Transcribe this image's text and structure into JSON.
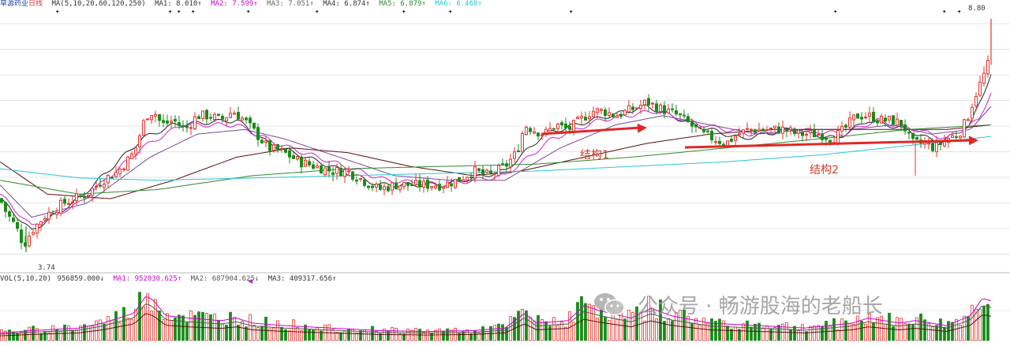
{
  "header": {
    "stock_name": "草源药业",
    "period": "日线",
    "ma_label": "MA(5,10,20,60,120,250)",
    "ma1": "MA1: 8.010↑",
    "ma2": "MA2: 7.599↑",
    "ma3": "MA3: 7.051↑",
    "ma4": "MA4: 6.874↑",
    "ma5": "MA5: 6.879↑",
    "ma6": "MA6: 6.468↑"
  },
  "volume_header": {
    "vol_label": "VOL(5,10,20)",
    "vol_value": "956859.000↓",
    "ma1": "MA1: 952030.625↑",
    "ma2": "MA2: 687904.625↓",
    "ma3": "MA3: 409317.656↑"
  },
  "colors": {
    "up": "#e8332d",
    "down": "#1a8a1a",
    "ma1": "#222222",
    "ma2": "#d020d0",
    "ma3": "#7a4a9a",
    "ma4": "#2e8b2e",
    "ma5": "#5a1010",
    "ma6": "#29c6d6",
    "arrow": "#e32626",
    "grid": "#e4e4e4",
    "header_ma1": "#333333",
    "header_ma2": "#cc00cc",
    "header_ma3": "#666666",
    "header_ma4": "#333333",
    "header_ma5": "#2e8b2e",
    "header_ma6": "#29c6d6"
  },
  "annotations": {
    "structure1": "结构1",
    "structure2": "结构2",
    "high_label": "8.80",
    "low_label": "3.74"
  },
  "watermark": {
    "text": "公众号 · 畅游股海的老船长"
  },
  "chart_data": {
    "type": "candlestick",
    "price_range": [
      3.74,
      8.8
    ],
    "low_price": 3.74,
    "high_price": 8.8,
    "moving_averages": [
      "MA5",
      "MA10",
      "MA20",
      "MA60",
      "MA120",
      "MA250"
    ],
    "volume_indicator": "VOL(5,10,20)",
    "close_path": [
      [
        0,
        4.9
      ],
      [
        8,
        4.6
      ],
      [
        20,
        4.3
      ],
      [
        30,
        3.9
      ],
      [
        40,
        4.2
      ],
      [
        55,
        4.5
      ],
      [
        80,
        4.8
      ],
      [
        110,
        5.0
      ],
      [
        130,
        5.3
      ],
      [
        150,
        5.5
      ],
      [
        170,
        5.9
      ],
      [
        185,
        6.7
      ],
      [
        195,
        6.8
      ],
      [
        205,
        6.5
      ],
      [
        220,
        6.6
      ],
      [
        235,
        6.4
      ],
      [
        250,
        6.7
      ],
      [
        265,
        6.7
      ],
      [
        280,
        6.6
      ],
      [
        295,
        6.8
      ],
      [
        310,
        6.6
      ],
      [
        325,
        6.3
      ],
      [
        340,
        6.0
      ],
      [
        360,
        5.9
      ],
      [
        380,
        5.7
      ],
      [
        400,
        5.6
      ],
      [
        420,
        5.5
      ],
      [
        440,
        5.5
      ],
      [
        460,
        5.3
      ],
      [
        480,
        5.1
      ],
      [
        500,
        5.2
      ],
      [
        520,
        5.2
      ],
      [
        540,
        5.2
      ],
      [
        560,
        5.2
      ],
      [
        580,
        5.3
      ],
      [
        600,
        5.5
      ],
      [
        620,
        5.4
      ],
      [
        640,
        5.6
      ],
      [
        655,
        5.9
      ],
      [
        665,
        6.5
      ],
      [
        675,
        6.4
      ],
      [
        690,
        6.3
      ],
      [
        705,
        6.5
      ],
      [
        720,
        6.4
      ],
      [
        735,
        6.6
      ],
      [
        750,
        6.8
      ],
      [
        765,
        6.8
      ],
      [
        780,
        6.7
      ],
      [
        795,
        6.8
      ],
      [
        810,
        6.9
      ],
      [
        820,
        7.0
      ],
      [
        830,
        6.9
      ],
      [
        845,
        6.8
      ],
      [
        860,
        6.7
      ],
      [
        875,
        6.5
      ],
      [
        890,
        6.3
      ],
      [
        905,
        6.2
      ],
      [
        920,
        6.1
      ],
      [
        935,
        6.3
      ],
      [
        950,
        6.4
      ],
      [
        965,
        6.4
      ],
      [
        980,
        6.4
      ],
      [
        995,
        6.4
      ],
      [
        1010,
        6.3
      ],
      [
        1025,
        6.3
      ],
      [
        1040,
        6.3
      ],
      [
        1055,
        6.2
      ],
      [
        1070,
        6.4
      ],
      [
        1085,
        6.7
      ],
      [
        1100,
        6.7
      ],
      [
        1115,
        6.6
      ],
      [
        1130,
        6.6
      ],
      [
        1145,
        6.5
      ],
      [
        1155,
        6.1
      ],
      [
        1170,
        6.1
      ],
      [
        1185,
        6.0
      ],
      [
        1200,
        6.2
      ],
      [
        1215,
        6.3
      ],
      [
        1225,
        6.6
      ],
      [
        1235,
        7.1
      ],
      [
        1245,
        7.5
      ],
      [
        1252,
        7.8
      ],
      [
        1256,
        8.5
      ]
    ],
    "ma_paths": {
      "MA5": [
        [
          0,
          4.9
        ],
        [
          40,
          4.2
        ],
        [
          100,
          4.9
        ],
        [
          180,
          6.2
        ],
        [
          220,
          6.5
        ],
        [
          300,
          6.6
        ],
        [
          340,
          6.1
        ],
        [
          420,
          5.6
        ],
        [
          480,
          5.2
        ],
        [
          560,
          5.2
        ],
        [
          640,
          5.5
        ],
        [
          690,
          6.3
        ],
        [
          750,
          6.6
        ],
        [
          820,
          6.9
        ],
        [
          880,
          6.5
        ],
        [
          940,
          6.2
        ],
        [
          1000,
          6.4
        ],
        [
          1060,
          6.2
        ],
        [
          1100,
          6.6
        ],
        [
          1150,
          6.4
        ],
        [
          1190,
          6.1
        ],
        [
          1230,
          6.5
        ],
        [
          1256,
          7.6
        ]
      ],
      "MA10": [
        [
          0,
          5.0
        ],
        [
          40,
          4.3
        ],
        [
          100,
          4.8
        ],
        [
          180,
          6.0
        ],
        [
          230,
          6.5
        ],
        [
          300,
          6.5
        ],
        [
          350,
          6.1
        ],
        [
          420,
          5.7
        ],
        [
          490,
          5.3
        ],
        [
          560,
          5.2
        ],
        [
          640,
          5.4
        ],
        [
          700,
          6.2
        ],
        [
          760,
          6.6
        ],
        [
          830,
          6.8
        ],
        [
          890,
          6.5
        ],
        [
          950,
          6.3
        ],
        [
          1010,
          6.4
        ],
        [
          1070,
          6.3
        ],
        [
          1110,
          6.6
        ],
        [
          1160,
          6.4
        ],
        [
          1200,
          6.2
        ],
        [
          1240,
          6.6
        ],
        [
          1256,
          7.2
        ]
      ],
      "MA20": [
        [
          0,
          5.2
        ],
        [
          40,
          4.5
        ],
        [
          110,
          4.8
        ],
        [
          190,
          5.8
        ],
        [
          250,
          6.3
        ],
        [
          310,
          6.4
        ],
        [
          360,
          6.2
        ],
        [
          430,
          5.8
        ],
        [
          500,
          5.4
        ],
        [
          570,
          5.3
        ],
        [
          640,
          5.3
        ],
        [
          710,
          6.0
        ],
        [
          780,
          6.5
        ],
        [
          840,
          6.7
        ],
        [
          900,
          6.5
        ],
        [
          960,
          6.3
        ],
        [
          1020,
          6.4
        ],
        [
          1080,
          6.4
        ],
        [
          1130,
          6.5
        ],
        [
          1180,
          6.3
        ],
        [
          1230,
          6.4
        ],
        [
          1256,
          6.9
        ]
      ],
      "MA60": [
        [
          0,
          5.7
        ],
        [
          60,
          5.0
        ],
        [
          140,
          4.9
        ],
        [
          220,
          5.3
        ],
        [
          300,
          5.8
        ],
        [
          370,
          6.0
        ],
        [
          440,
          5.9
        ],
        [
          520,
          5.6
        ],
        [
          600,
          5.4
        ],
        [
          660,
          5.5
        ],
        [
          740,
          5.8
        ],
        [
          820,
          6.1
        ],
        [
          900,
          6.3
        ],
        [
          980,
          6.4
        ],
        [
          1060,
          6.4
        ],
        [
          1140,
          6.4
        ],
        [
          1200,
          6.4
        ],
        [
          1256,
          6.5
        ]
      ],
      "MA120": [
        [
          0,
          5.3
        ],
        [
          100,
          5.0
        ],
        [
          200,
          5.1
        ],
        [
          320,
          5.4
        ],
        [
          440,
          5.55
        ],
        [
          560,
          5.6
        ],
        [
          680,
          5.65
        ],
        [
          800,
          5.8
        ],
        [
          920,
          6.0
        ],
        [
          1040,
          6.2
        ],
        [
          1150,
          6.4
        ],
        [
          1256,
          6.5
        ]
      ],
      "MA250": [
        [
          0,
          5.55
        ],
        [
          100,
          5.35
        ],
        [
          200,
          5.3
        ],
        [
          320,
          5.35
        ],
        [
          440,
          5.4
        ],
        [
          560,
          5.45
        ],
        [
          680,
          5.5
        ],
        [
          800,
          5.6
        ],
        [
          920,
          5.7
        ],
        [
          1040,
          5.85
        ],
        [
          1150,
          6.05
        ],
        [
          1256,
          6.25
        ]
      ]
    },
    "volume_profile": [
      [
        0,
        0.15
      ],
      [
        40,
        0.2
      ],
      [
        100,
        0.25
      ],
      [
        130,
        0.35
      ],
      [
        170,
        0.55
      ],
      [
        185,
        0.9
      ],
      [
        195,
        0.8
      ],
      [
        210,
        0.5
      ],
      [
        240,
        0.45
      ],
      [
        280,
        0.4
      ],
      [
        300,
        0.45
      ],
      [
        320,
        0.35
      ],
      [
        360,
        0.3
      ],
      [
        420,
        0.25
      ],
      [
        480,
        0.2
      ],
      [
        540,
        0.18
      ],
      [
        600,
        0.2
      ],
      [
        640,
        0.25
      ],
      [
        665,
        0.55
      ],
      [
        680,
        0.35
      ],
      [
        720,
        0.4
      ],
      [
        740,
        0.7
      ],
      [
        760,
        0.6
      ],
      [
        800,
        0.45
      ],
      [
        825,
        0.65
      ],
      [
        850,
        0.5
      ],
      [
        900,
        0.35
      ],
      [
        960,
        0.3
      ],
      [
        1020,
        0.25
      ],
      [
        1080,
        0.35
      ],
      [
        1100,
        0.45
      ],
      [
        1140,
        0.35
      ],
      [
        1160,
        0.4
      ],
      [
        1200,
        0.3
      ],
      [
        1230,
        0.5
      ],
      [
        1245,
        0.85
      ],
      [
        1256,
        0.8
      ]
    ]
  }
}
